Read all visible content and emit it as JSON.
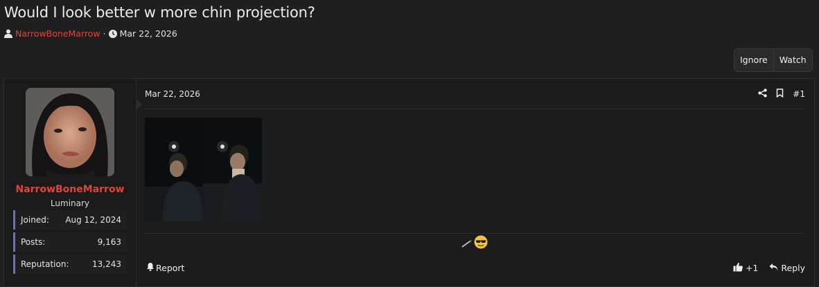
{
  "thread": {
    "title": "Would I look better w more chin projection?",
    "author": "NarrowBoneMarrow",
    "separator": "·",
    "date": "Mar 22, 2026"
  },
  "actions": {
    "ignore_label": "Ignore",
    "watch_label": "Watch"
  },
  "post": {
    "date": "Mar 22, 2026",
    "number": "#1",
    "report_label": "Report",
    "like_count": "+1",
    "reply_label": "Reply",
    "reactions": [
      "pen-emoji",
      "sunglasses-face-emoji"
    ]
  },
  "user": {
    "name": "NarrowBoneMarrow",
    "title": "Luminary",
    "stats": [
      {
        "label": "Joined:",
        "value": "Aug 12, 2024"
      },
      {
        "label": "Posts:",
        "value": "9,163"
      },
      {
        "label": "Reputation:",
        "value": "13,243"
      }
    ]
  },
  "colors": {
    "background": "#1f1f1f",
    "author_red": "#e0453a",
    "stat_accent": "#6570c9"
  }
}
